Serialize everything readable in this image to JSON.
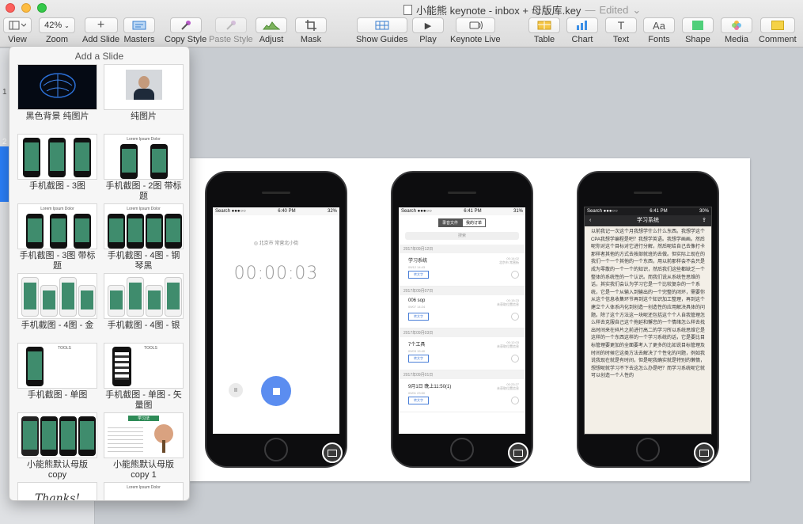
{
  "window": {
    "title": "小能熊 keynote - inbox + 母版库.key",
    "separator": "—",
    "status": "Edited",
    "status_chevron": "⌄"
  },
  "toolbar": {
    "view_label": "View",
    "zoom_value": "42%",
    "zoom_label": "Zoom",
    "add_slide_label": "Add Slide",
    "masters_label": "Masters",
    "copy_style_label": "Copy Style",
    "paste_style_label": "Paste Style",
    "adjust_label": "Adjust",
    "mask_label": "Mask",
    "show_guides_label": "Show Guides",
    "play_label": "Play",
    "keynote_live_label": "Keynote Live",
    "table_label": "Table",
    "chart_label": "Chart",
    "text_label": "Text",
    "text_icon_glyph": "T",
    "fonts_label": "Fonts",
    "fonts_icon_glyph": "Aa",
    "shape_label": "Shape",
    "media_label": "Media",
    "comment_label": "Comment"
  },
  "navigator": {
    "slide_numbers": [
      "1",
      "2"
    ]
  },
  "popover": {
    "title": "Add a Slide",
    "masters": [
      {
        "caption": "黑色背景 纯图片"
      },
      {
        "caption": "纯图片"
      },
      {
        "caption": "手机截图 - 3图"
      },
      {
        "caption": "手机截图 - 2图 带标题",
        "thumb_title": "Lorem Ipsum Dolor"
      },
      {
        "caption": "手机截图 - 3图 带标题",
        "thumb_title": "Lorem Ipsum Dolor"
      },
      {
        "caption": "手机截图 - 4图 - 钢琴黑",
        "thumb_title": "Lorem Ipsum Dolor"
      },
      {
        "caption": "手机截图 - 4图 - 金"
      },
      {
        "caption": "手机截图 - 4图 - 银"
      },
      {
        "caption": "手机截图 - 单图",
        "thumb_title": "TOOLS"
      },
      {
        "caption": "手机截图 - 单图 - 矢量图",
        "thumb_title": "TOOLS"
      },
      {
        "caption": "小能熊默认母版 copy",
        "thumb_title": ""
      },
      {
        "caption": "小能熊默认母版 copy 1",
        "thumb_title": "学习法"
      },
      {
        "caption": "",
        "thumb_title": "Thanks!"
      },
      {
        "caption": "",
        "thumb_title": "Lorem Ipsum Dolor"
      }
    ]
  },
  "slide": {
    "phone1": {
      "status_left": "Search ●●●○○",
      "status_time": "6:40 PM",
      "status_right": "32%",
      "location": "◎ 北京市 常营北小街",
      "timer": "00:00:03",
      "pause_glyph": "II"
    },
    "phone2": {
      "status_left": "Search ●●●○○",
      "status_time": "6:41 PM",
      "status_right": "31%",
      "tab_on": "录音文件",
      "tab_off": "我的订单",
      "search_placeholder": "搜索",
      "groups": [
        {
          "date": "2017年09月12日",
          "title": "学习系统",
          "sub": "09/12 14:43",
          "right_top": "00:14:02",
          "right_bottom": "北京市 常营街",
          "button": "转文字"
        },
        {
          "date": "2017年09月07日",
          "title": "006 sop",
          "sub": "09/07 14:24",
          "right_top": "00:15:23",
          "right_bottom": "未获取位置信息",
          "button": "转文字"
        },
        {
          "date": "2017年09月03日",
          "title": "7个工具",
          "sub": "09/03 15:40",
          "right_top": "00:12:03",
          "right_bottom": "未获取位置信息",
          "button": "转文字"
        },
        {
          "date": "2017年09月01日",
          "title": "9月1日 晚上11:50(1)",
          "sub": "09/01 23:50",
          "right_top": "00:23:27",
          "right_bottom": "未获取位置信息",
          "button": "转文字"
        }
      ]
    },
    "phone3": {
      "status_left": "Search ●●●○○",
      "status_time": "6:41 PM",
      "status_right": "30%",
      "nav_title": "学习系统",
      "body": "以前我记一次这个月我想学什么什么东西。我想学这个CPA我想学编程是吧？我想学英语。我想学画画。然后呢你对这个目标对它进行分解，然后呢给自己去像打卡那样者其他的方式去按部就班的去做。但实际上现在的我们一个一个其他的一个东西，用以前那样会不会只是成为零散的一个一个的知识，然后我们这些都缺乏一个整体的系统性的一个认识。而我们说从系统性思维的话，其实我们会认为学习它是一个比较复杂的一个系统，它是一个从输入到输出的一个完整的闭环，需要你从这个信息收集环节再到这个知识加工整理，再到这个建立个人体系内化到创造一创造性的应用解决具体的问题。除了这个方法这一块呢还包括这个个人自我管理怎么样去克服自己这个拖延和懈怠的一个情绪怎么样去找出时间来在碎片之前进行高二的学习所以系统思维它是这样的一个东西这样的一个学习系统的话，它是要比目标管理要更加的全面要考入了更多的比如说目标管理及时间的时候它这类方法去解决了个性化的问题，例如我说我现在就是有时间，但是呢我确实就是特别的懒惰，想想呢就学习不下去这怎么办是吧？而学习系统呢它就可以创造一个人性的"
    }
  }
}
